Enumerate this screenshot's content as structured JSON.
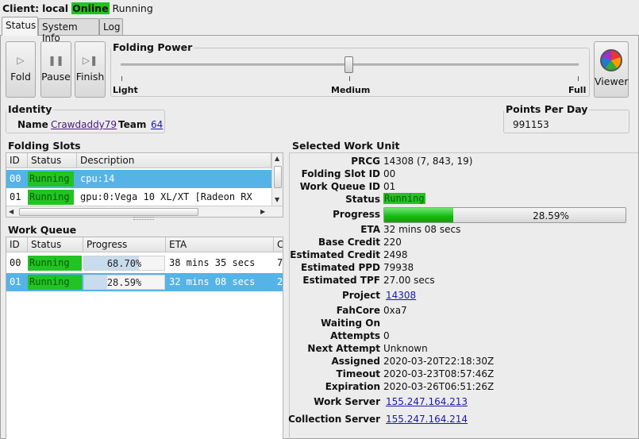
{
  "client": {
    "prefix": "Client:",
    "name": "local",
    "state": "Online",
    "status": "Running"
  },
  "tabs": [
    {
      "label": "Status"
    },
    {
      "label": "System Info"
    },
    {
      "label": "Log"
    }
  ],
  "controls": {
    "fold": "Fold",
    "pause": "Pause",
    "finish": "Finish",
    "viewer": "Viewer"
  },
  "folding_power": {
    "title": "Folding Power",
    "labels": {
      "light": "Light",
      "medium": "Medium",
      "full": "Full"
    },
    "level": 0.5
  },
  "identity": {
    "title": "Identity",
    "name_label": "Name",
    "name_value": "Crawdaddy79",
    "team_label": "Team",
    "team_value": "64"
  },
  "points": {
    "title": "Points Per Day",
    "value": "991153"
  },
  "folding_slots": {
    "title": "Folding Slots",
    "columns": [
      "ID",
      "Status",
      "Description"
    ],
    "rows": [
      {
        "id": "00",
        "status": "Running",
        "description": "cpu:14"
      },
      {
        "id": "01",
        "status": "Running",
        "description": "gpu:0:Vega 10 XL/XT [Radeon RX"
      }
    ]
  },
  "work_queue": {
    "title": "Work Queue",
    "columns": [
      "ID",
      "Status",
      "Progress",
      "ETA",
      "Cr"
    ],
    "rows": [
      {
        "id": "00",
        "status": "Running",
        "progress": "68.70%",
        "progress_value": 0.687,
        "eta": "38 mins 35 secs",
        "credit": "7"
      },
      {
        "id": "01",
        "status": "Running",
        "progress": "28.59%",
        "progress_value": 0.2859,
        "eta": "32 mins 08 secs",
        "credit": "2"
      }
    ]
  },
  "work_unit": {
    "title": "Selected Work Unit",
    "prcg": {
      "label": "PRCG",
      "value": "14308 (7, 843, 19)"
    },
    "slot_id": {
      "label": "Folding Slot ID",
      "value": "00"
    },
    "queue_id": {
      "label": "Work Queue ID",
      "value": "01"
    },
    "status": {
      "label": "Status",
      "value": "Running"
    },
    "progress": {
      "label": "Progress",
      "value": "28.59%",
      "fraction": 0.2859
    },
    "eta": {
      "label": "ETA",
      "value": "32 mins 08 secs"
    },
    "base_credit": {
      "label": "Base Credit",
      "value": "220"
    },
    "est_credit": {
      "label": "Estimated Credit",
      "value": "2498"
    },
    "est_ppd": {
      "label": "Estimated PPD",
      "value": "79938"
    },
    "est_tpf": {
      "label": "Estimated TPF",
      "value": "27.00 secs"
    },
    "project": {
      "label": "Project",
      "value": "14308"
    },
    "fahcore": {
      "label": "FahCore",
      "value": "0xa7"
    },
    "waiting_on": {
      "label": "Waiting On",
      "value": ""
    },
    "attempts": {
      "label": "Attempts",
      "value": "0"
    },
    "next_attempt": {
      "label": "Next Attempt",
      "value": "Unknown"
    },
    "assigned": {
      "label": "Assigned",
      "value": "2020-03-20T22:18:30Z"
    },
    "timeout": {
      "label": "Timeout",
      "value": "2020-03-23T08:57:46Z"
    },
    "expiration": {
      "label": "Expiration",
      "value": "2020-03-26T06:51:26Z"
    },
    "work_server": {
      "label": "Work Server",
      "value": "155.247.164.213"
    },
    "collection_server": {
      "label": "Collection Server",
      "value": "155.247.164.214"
    }
  },
  "colors": {
    "running": "#22c322",
    "selection": "#56b3e8",
    "progress_green": "#14b814",
    "link": "#1a1aa8"
  }
}
